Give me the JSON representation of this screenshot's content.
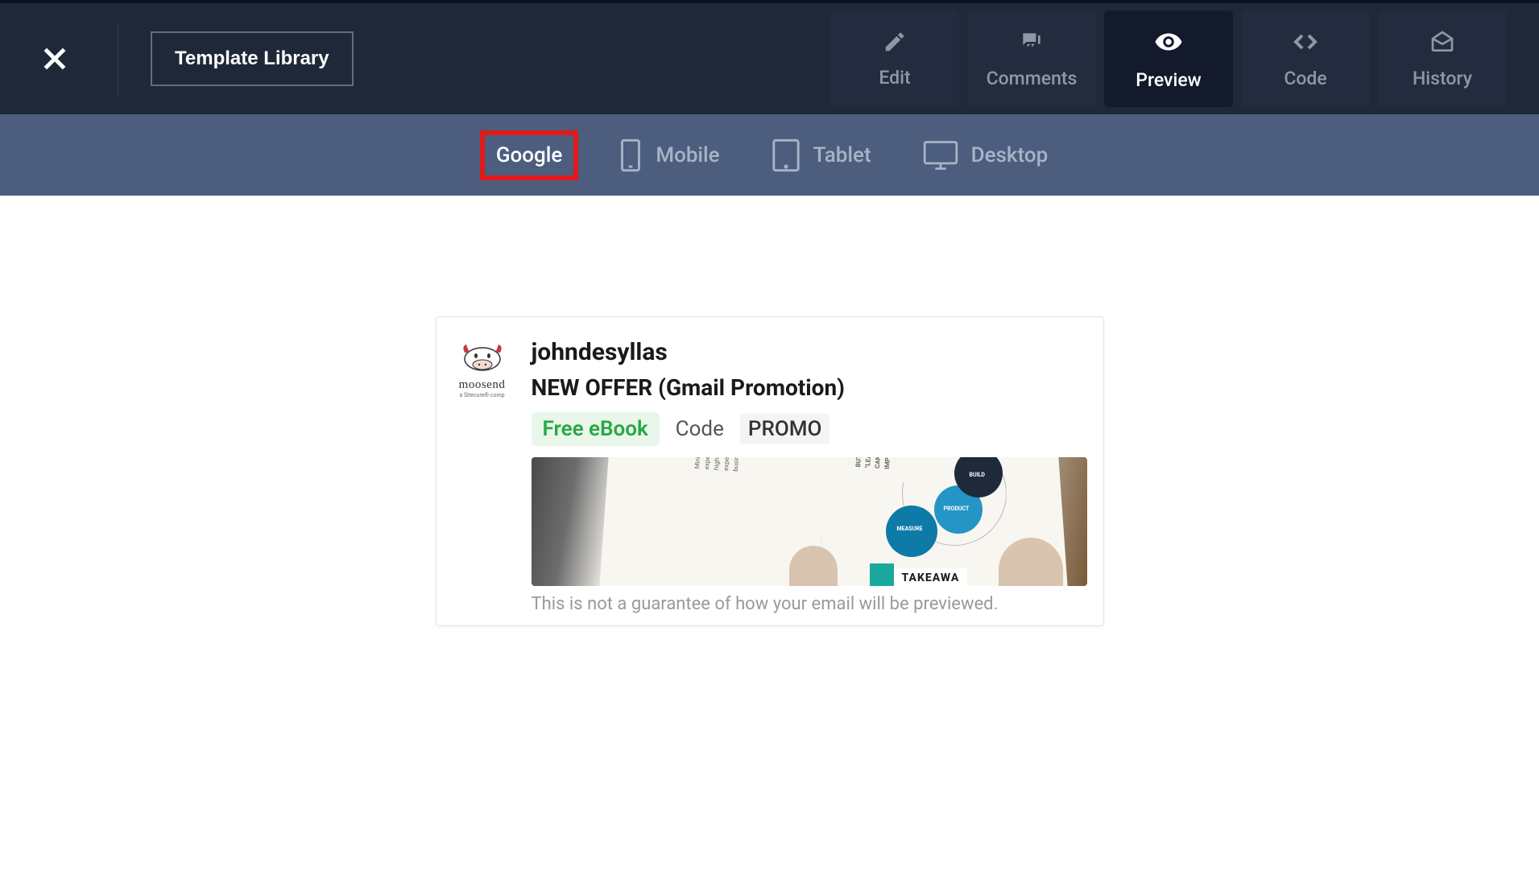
{
  "header": {
    "template_library": "Template Library",
    "tabs": [
      {
        "id": "edit",
        "label": "Edit",
        "icon": "pencil-icon",
        "active": false
      },
      {
        "id": "comments",
        "label": "Comments",
        "icon": "comments-icon",
        "active": false
      },
      {
        "id": "preview",
        "label": "Preview",
        "icon": "eye-icon",
        "active": true
      },
      {
        "id": "code",
        "label": "Code",
        "icon": "code-icon",
        "active": false
      },
      {
        "id": "history",
        "label": "History",
        "icon": "envelope-open-icon",
        "active": false
      }
    ]
  },
  "preview_bar": {
    "devices": [
      {
        "id": "google",
        "label": "Google",
        "icon": null,
        "active": true
      },
      {
        "id": "mobile",
        "label": "Mobile",
        "icon": "mobile-icon",
        "active": false
      },
      {
        "id": "tablet",
        "label": "Tablet",
        "icon": "tablet-icon",
        "active": false
      },
      {
        "id": "desktop",
        "label": "Desktop",
        "icon": "desktop-icon",
        "active": false
      }
    ]
  },
  "email_card": {
    "brand_name": "moosend",
    "brand_subtitle": "a Sitecore® comp",
    "sender": "johndesyllas",
    "subject": "NEW OFFER (Gmail Promotion)",
    "badge": "Free eBook",
    "code_label": "Code",
    "code_value": "PROMO",
    "hero": {
      "text_a": "Minimum Desirable Product simplest experience necessary to prove out a high-value, satisfying product experience for users independence of business viability.",
      "text_b": "BUT WHAT ABOUT TH SURE—AND \"LEAN\" KEY PARTS OF THE LE SO YOU CAN CONTINU ITERATE AND IMPROVE",
      "circle_labels": {
        "measure": "MEASURE",
        "product": "PRODUCT",
        "build": "BUILD"
      },
      "takeaway": "TAKEAWA"
    },
    "disclaimer": "This is not a guarantee of how your email will be previewed."
  }
}
